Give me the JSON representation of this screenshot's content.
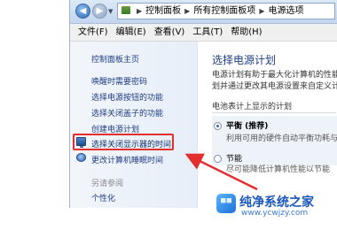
{
  "address_bar": {
    "crumbs": [
      "控制面板",
      "所有控制面板项",
      "电源选项"
    ]
  },
  "menu": [
    "文件(F)",
    "编辑(E)",
    "查看(V)",
    "工具(T)",
    "帮助(H)"
  ],
  "left_pane": {
    "home_link": "控制面板主页",
    "links": [
      "唤醒时需要密码",
      "选择电源按钮的功能",
      "选择关闭盖子的功能",
      "创建电源计划",
      "选择关闭显示器的时间",
      "更改计算机睡眠时间"
    ],
    "see_also": "另请参阅",
    "personalize": "个性化"
  },
  "right_pane": {
    "title": "选择电源计划",
    "desc_line1": "电源计划有助于最大化计算机的性能",
    "desc_line2": "划并通过更改其电源设置来自定义计",
    "battery_label": "电池表计上显示的计划",
    "plans": [
      {
        "name": "平衡 (推荐)",
        "desc": "利用可用的硬件自动平衡功耗与",
        "selected": true
      },
      {
        "name": "节能",
        "desc": "尽可能降低计算机性能以节能",
        "selected": false
      }
    ]
  },
  "highlight_color": "#e3302f",
  "watermark": {
    "title": "纯净系统之家",
    "url": "www.ycwjzy.com"
  }
}
